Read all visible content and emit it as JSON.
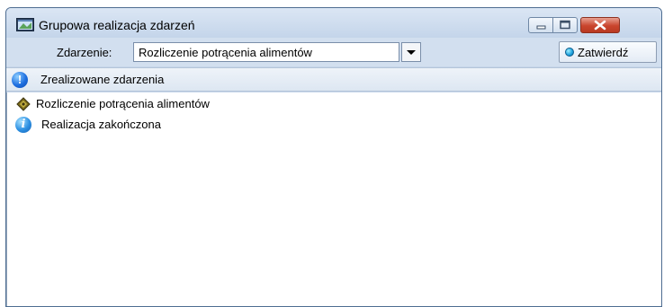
{
  "window": {
    "title": "Grupowa realizacja zdarzeń",
    "close_color": "#c9452d"
  },
  "toolbar": {
    "event_label": "Zdarzenie:",
    "event_value": "Rozliczenie potrącenia alimentów",
    "confirm_label": "Zatwierdź"
  },
  "section": {
    "title": "Zrealizowane zdarzenia",
    "icon": "exclamation-icon"
  },
  "results": [
    {
      "icon": "event-tag-icon",
      "label": "Rozliczenie potrącenia alimentów"
    },
    {
      "icon": "info-icon",
      "label": "Realizacja zakończona"
    }
  ]
}
